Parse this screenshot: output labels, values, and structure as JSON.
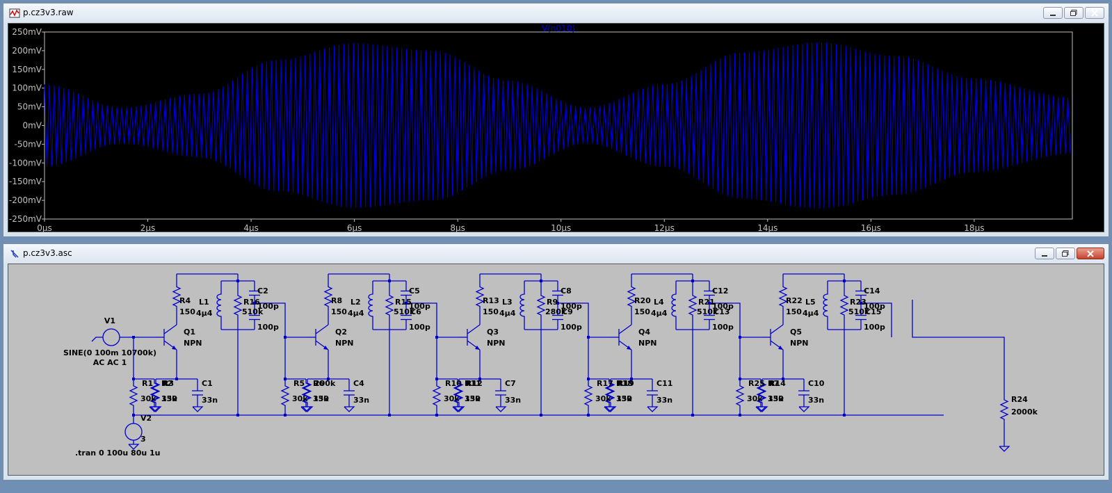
{
  "waveform_window": {
    "title": "p.cz3v3.raw",
    "trace_name": "V(n010)",
    "colors": {
      "trace": "#0000e6",
      "plot_bg": "#000000",
      "frame": "#c0c0c0",
      "label": "#c0c0c0"
    }
  },
  "schematic_window": {
    "title": "p.cz3v3.asc",
    "labels": {
      "v1_name": "V1",
      "v1_value": "SINE(0 100m 10700k)",
      "v1_ac": "AC AC 1",
      "v2_name": "V2",
      "v2_value": "3",
      "directive": ".tran 0 100u 80u 1u",
      "r24_name": "R24",
      "r24_value": "2000k",
      "npn": "NPN",
      "ind": "4μ4",
      "cap100": "100p",
      "cap33": "33n",
      "r30k": "30k",
      "r15k": "15k",
      "r330": "330",
      "r150": "150",
      "r510k": "510k",
      "r200k": "200k",
      "r280k": "280k"
    },
    "stages": [
      {
        "q": "Q1",
        "rc": "R4",
        "l": "L1",
        "rp": "R16",
        "ct": "C2",
        "rb1": "R1",
        "rb2": "R2",
        "re": "R3",
        "ce": "C1",
        "cc": "",
        "re_val": "330"
      },
      {
        "q": "Q2",
        "rc": "R8",
        "l": "L2",
        "rp": "R15",
        "ct": "C5",
        "rb1": "R5",
        "rb2": "R6",
        "re": "200k",
        "ce": "C4",
        "cc": "C6",
        "re_val": "330"
      },
      {
        "q": "Q3",
        "rc": "R13",
        "l": "L3",
        "rp": "R9",
        "ct": "C8",
        "rb1": "R10",
        "rb2": "R11",
        "re": "R12",
        "ce": "C7",
        "cc": "C9",
        "re_val": "330"
      },
      {
        "q": "Q4",
        "rc": "R20",
        "l": "L4",
        "rp": "R21",
        "ct": "C12",
        "rb1": "R17",
        "rb2": "R18",
        "re": "R19",
        "ce": "C11",
        "cc": "C13",
        "re_val": "330"
      },
      {
        "q": "Q5",
        "rc": "R22",
        "l": "L5",
        "rp": "R23",
        "ct": "C14",
        "rb1": "R25",
        "rb2": "R7",
        "re": "R14",
        "ce": "C10",
        "cc": "C15",
        "re_val": "330"
      }
    ],
    "colors": {
      "wire": "#0000cc",
      "text": "#000000",
      "bg": "#bfbfbf"
    }
  },
  "chart_data": {
    "type": "line",
    "title": "V(n010)",
    "xlabel": "",
    "ylabel": "",
    "xlim": [
      0,
      19.9
    ],
    "ylim": [
      -250,
      250
    ],
    "x_ticks": [
      "0μs",
      "2μs",
      "4μs",
      "6μs",
      "8μs",
      "10μs",
      "12μs",
      "14μs",
      "16μs",
      "18μs"
    ],
    "x_tick_values": [
      0,
      2,
      4,
      6,
      8,
      10,
      12,
      14,
      16,
      18
    ],
    "y_ticks": [
      "250mV",
      "200mV",
      "150mV",
      "100mV",
      "50mV",
      "0mV",
      "-50mV",
      "-100mV",
      "-150mV",
      "-200mV",
      "-250mV"
    ],
    "y_tick_values": [
      250,
      200,
      150,
      100,
      50,
      0,
      -50,
      -100,
      -150,
      -200,
      -250
    ],
    "carrier_mhz": 10.7,
    "series": [
      {
        "name": "V(n010)",
        "envelope_t_us": [
          0,
          1.5,
          3,
          4.5,
          6,
          7.5,
          9,
          10.5,
          12,
          13.5,
          15,
          16.5,
          18,
          19.9
        ],
        "envelope_mv": [
          110,
          48,
          85,
          175,
          220,
          200,
          120,
          48,
          110,
          195,
          222,
          185,
          125,
          75
        ]
      }
    ]
  }
}
